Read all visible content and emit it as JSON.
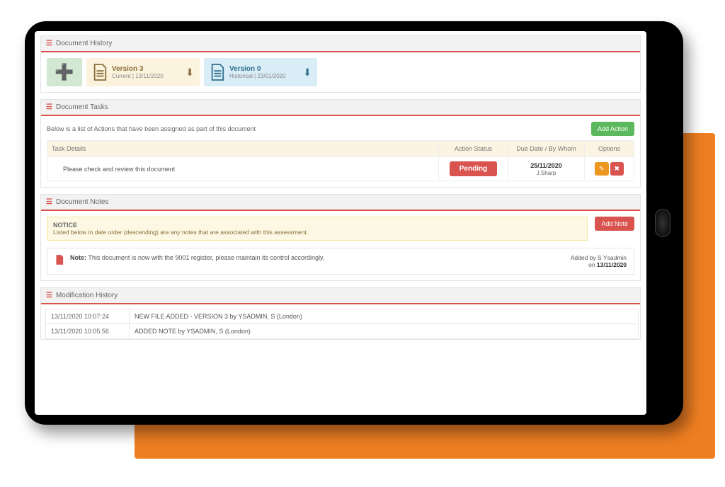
{
  "panels": {
    "history": {
      "title": "Document History"
    },
    "tasks": {
      "title": "Document Tasks"
    },
    "notes": {
      "title": "Document Notes"
    },
    "mods": {
      "title": "Modification History"
    }
  },
  "versions": [
    {
      "title": "Version 3",
      "meta": "Current | 13/11/2020",
      "kind": "current"
    },
    {
      "title": "Version 0",
      "meta": "Historical | 23/01/2020",
      "kind": "historical"
    }
  ],
  "tasks": {
    "intro": "Below is a list of Actions that have been assigned as part of this document",
    "add_label": "Add Action",
    "columns": {
      "details": "Task Details",
      "status": "Action Status",
      "due": "Due Date / By Whom",
      "options": "Options"
    },
    "row": {
      "details": "Please check and review this document",
      "status": "Pending",
      "due_date": "25/11/2020",
      "due_by": "J.Sharp"
    }
  },
  "notes": {
    "notice_title": "NOTICE",
    "notice_text": "Listed below in date order (descending) are any notes that are associated with this assessment.",
    "add_label": "Add Note",
    "note": {
      "label": "Note:",
      "text": "This document is now with the 9001 register, please maintain its control accordingly.",
      "added_prefix": "Added by ",
      "added_by": "S Ysadmin",
      "on_prefix": "on ",
      "added_on": "13/11/2020"
    }
  },
  "mods": [
    {
      "ts": "13/11/2020 10:07:24",
      "text": "NEW FILE ADDED - VERSION 3 by YSADMIN, S (London)"
    },
    {
      "ts": "13/11/2020 10:05:56",
      "text": "ADDED NOTE by YSADMIN, S (London)"
    }
  ]
}
